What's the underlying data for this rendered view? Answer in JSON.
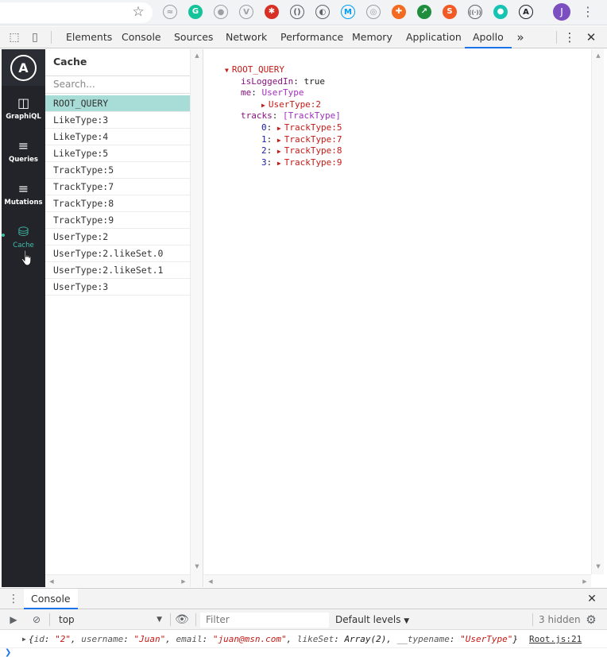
{
  "browser": {
    "extensions": [
      {
        "name": "ext-wave-icon",
        "glyph": "≈",
        "color": "#9aa0a6"
      },
      {
        "name": "grammarly-icon",
        "glyph": "G",
        "color": "#15c39a"
      },
      {
        "name": "ext-circle-icon",
        "glyph": "●",
        "color": "#9aa0a6"
      },
      {
        "name": "vue-devtools-icon",
        "glyph": "V",
        "color": "#9aa0a6"
      },
      {
        "name": "ext-bug-icon",
        "glyph": "✱",
        "color": "#d93025"
      },
      {
        "name": "ext-brackets-icon",
        "glyph": "()",
        "color": "#5f6368"
      },
      {
        "name": "ext-moon-icon",
        "glyph": "◐",
        "color": "#5f6368"
      },
      {
        "name": "movistar-icon",
        "glyph": "M",
        "color": "#019df4"
      },
      {
        "name": "ext-target-icon",
        "glyph": "◎",
        "color": "#9aa0a6"
      },
      {
        "name": "ext-lifebuoy-icon",
        "glyph": "✚",
        "color": "#f36b21"
      },
      {
        "name": "ext-arrow-icon",
        "glyph": "↗",
        "color": "#1e8e3e"
      },
      {
        "name": "ext-s-icon",
        "glyph": "S",
        "color": "#f15a24"
      },
      {
        "name": "ext-radio-icon",
        "glyph": "((·))",
        "color": "#5f6368"
      },
      {
        "name": "ext-bubble-icon",
        "glyph": "●",
        "color": "#17c3b2"
      },
      {
        "name": "apollo-ext-icon",
        "glyph": "A",
        "color": "#202124"
      }
    ],
    "profile_initial": "J"
  },
  "devtools": {
    "tabs": [
      "Elements",
      "Console",
      "Sources",
      "Network",
      "Performance",
      "Memory",
      "Application",
      "Apollo"
    ],
    "active_tab": "Apollo",
    "more_tabs": "»"
  },
  "apollo": {
    "logo": "A",
    "nav": [
      {
        "label": "GraphiQL",
        "glyph": "◫"
      },
      {
        "label": "Queries",
        "glyph": "≡"
      },
      {
        "label": "Mutations",
        "glyph": "≡"
      },
      {
        "label": "Cache",
        "glyph": "⛁"
      }
    ],
    "active_nav": "Cache",
    "cache": {
      "title": "Cache",
      "search_placeholder": "Search...",
      "items": [
        "ROOT_QUERY",
        "LikeType:3",
        "LikeType:4",
        "LikeType:5",
        "TrackType:5",
        "TrackType:7",
        "TrackType:8",
        "TrackType:9",
        "UserType:2",
        "UserType:2.likeSet.0",
        "UserType:2.likeSet.1",
        "UserType:3"
      ],
      "selected": "ROOT_QUERY"
    },
    "tree": {
      "root": "ROOT_QUERY",
      "isLoggedIn_key": "isLoggedIn",
      "isLoggedIn_value": "true",
      "me_key": "me",
      "me_type": "UserType",
      "me_ref": "UserType:2",
      "tracks_key": "tracks",
      "tracks_type": "[TrackType]",
      "tracks": [
        {
          "index": "0",
          "ref": "TrackType:5"
        },
        {
          "index": "1",
          "ref": "TrackType:7"
        },
        {
          "index": "2",
          "ref": "TrackType:8"
        },
        {
          "index": "3",
          "ref": "TrackType:9"
        }
      ]
    }
  },
  "console": {
    "tab_label": "Console",
    "context": "top",
    "filter_placeholder": "Filter",
    "levels": "Default levels",
    "hidden": "3 hidden",
    "log": {
      "open": "{",
      "id_key": "id",
      "id_val": "\"2\"",
      "username_key": "username",
      "username_val": "\"Juan\"",
      "email_key": "email",
      "email_val": "\"juan@msn.com\"",
      "likeset_key": "likeSet",
      "likeset_val": "Array(2)",
      "typename_key": "__typename",
      "typename_val": "\"UserType\"",
      "close": "}",
      "source": "Root.js:21"
    }
  }
}
